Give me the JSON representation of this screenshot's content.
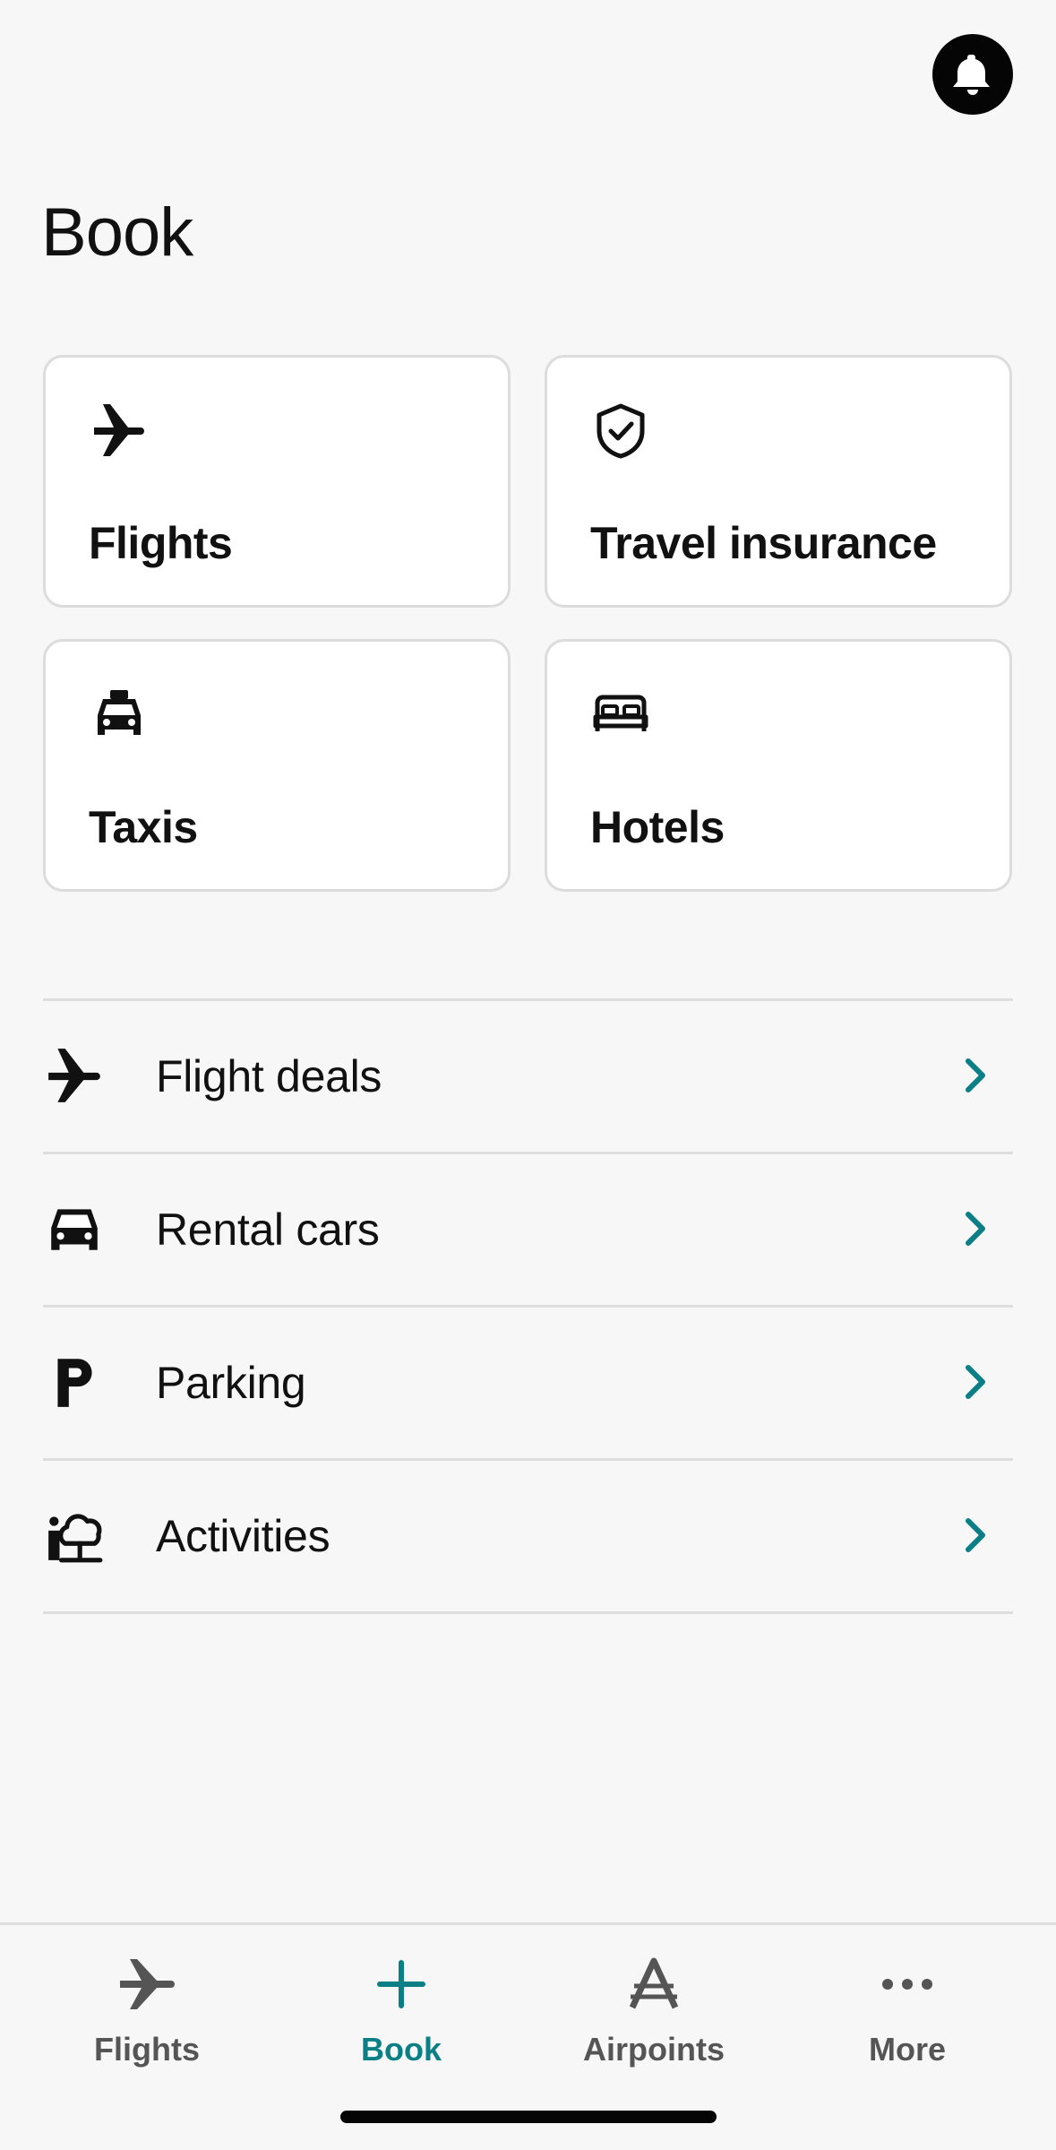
{
  "header": {
    "notifications_icon": "bell-icon"
  },
  "page": {
    "title": "Book"
  },
  "cards": [
    {
      "label": "Flights",
      "icon": "plane-icon"
    },
    {
      "label": "Travel insurance",
      "icon": "shield-check-icon"
    },
    {
      "label": "Taxis",
      "icon": "taxi-icon"
    },
    {
      "label": "Hotels",
      "icon": "bed-icon"
    }
  ],
  "list": [
    {
      "label": "Flight deals",
      "icon": "plane-icon"
    },
    {
      "label": "Rental cars",
      "icon": "car-icon"
    },
    {
      "label": "Parking",
      "icon": "parking-icon"
    },
    {
      "label": "Activities",
      "icon": "activities-icon"
    }
  ],
  "tabs": [
    {
      "label": "Flights",
      "icon": "plane-icon",
      "active": false
    },
    {
      "label": "Book",
      "icon": "plus-icon",
      "active": true
    },
    {
      "label": "Airpoints",
      "icon": "airpoints-icon",
      "active": false
    },
    {
      "label": "More",
      "icon": "more-dots-icon",
      "active": false
    }
  ],
  "colors": {
    "accent": "#0a7f86",
    "inactive": "#555555",
    "background": "#f7f7f7"
  }
}
